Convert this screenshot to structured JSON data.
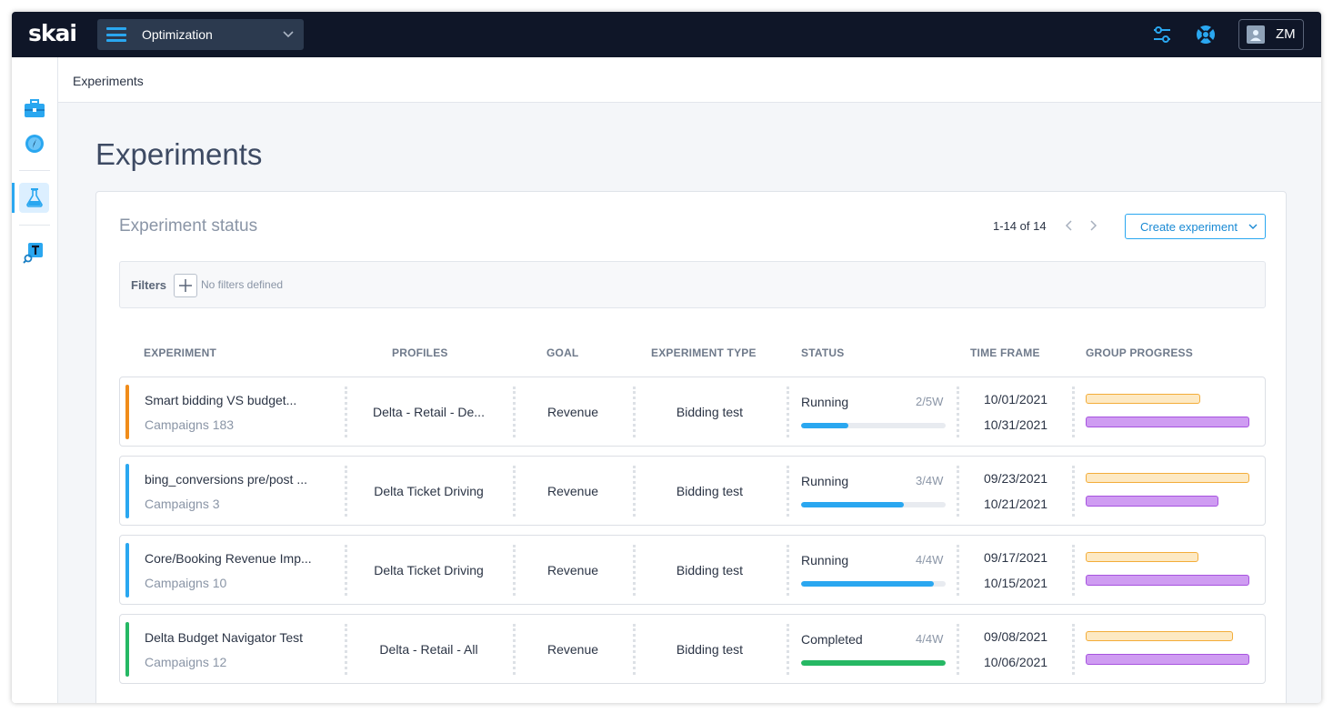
{
  "app": {
    "logo": "skai",
    "module": "Optimization",
    "user_initials": "ZM",
    "colors": {
      "topbar": "#0f1628",
      "accent": "#2aa7f0"
    }
  },
  "sidebar": {
    "items": [
      {
        "icon": "briefcase-icon"
      },
      {
        "icon": "compass-icon"
      },
      {
        "icon": "flask-icon",
        "active": true
      },
      {
        "icon": "text-search-icon"
      }
    ]
  },
  "breadcrumb": "Experiments",
  "page_title": "Experiments",
  "card": {
    "title": "Experiment status",
    "pagination": "1-14 of 14",
    "create_label": "Create experiment",
    "filters": {
      "label": "Filters",
      "empty": "No filters defined"
    },
    "columns": [
      "EXPERIMENT",
      "PROFILES",
      "GOAL",
      "EXPERIMENT TYPE",
      "STATUS",
      "TIME FRAME",
      "GROUP PROGRESS"
    ],
    "rows": [
      {
        "name": "Smart bidding VS budget...",
        "campaigns": "Campaigns 183",
        "profile": "Delta - Retail - De...",
        "goal": "Revenue",
        "type": "Bidding test",
        "status": "Running",
        "weeks": "2/5W",
        "progress": 0.33,
        "progress_color": "#2aa7f0",
        "start": "10/01/2021",
        "end": "10/31/2021",
        "group_a": 0.7,
        "group_b": 1.0,
        "accent": "#f08c1a"
      },
      {
        "name": "bing_conversions pre/post ...",
        "campaigns": "Campaigns 3",
        "profile": "Delta Ticket Driving",
        "goal": "Revenue",
        "type": "Bidding test",
        "status": "Running",
        "weeks": "3/4W",
        "progress": 0.71,
        "progress_color": "#2aa7f0",
        "start": "09/23/2021",
        "end": "10/21/2021",
        "group_a": 1.0,
        "group_b": 0.81,
        "accent": "#2aa7f0"
      },
      {
        "name": "Core/Booking Revenue Imp...",
        "campaigns": "Campaigns 10",
        "profile": "Delta Ticket Driving",
        "goal": "Revenue",
        "type": "Bidding test",
        "status": "Running",
        "weeks": "4/4W",
        "progress": 0.92,
        "progress_color": "#2aa7f0",
        "start": "09/17/2021",
        "end": "10/15/2021",
        "group_a": 0.69,
        "group_b": 1.0,
        "accent": "#2aa7f0"
      },
      {
        "name": "Delta Budget Navigator Test",
        "campaigns": "Campaigns 12",
        "profile": "Delta - Retail - All",
        "goal": "Revenue",
        "type": "Bidding test",
        "status": "Completed",
        "weeks": "4/4W",
        "progress": 1.0,
        "progress_color": "#26b864",
        "start": "09/08/2021",
        "end": "10/06/2021",
        "group_a": 0.9,
        "group_b": 1.0,
        "accent": "#26b864"
      }
    ]
  }
}
